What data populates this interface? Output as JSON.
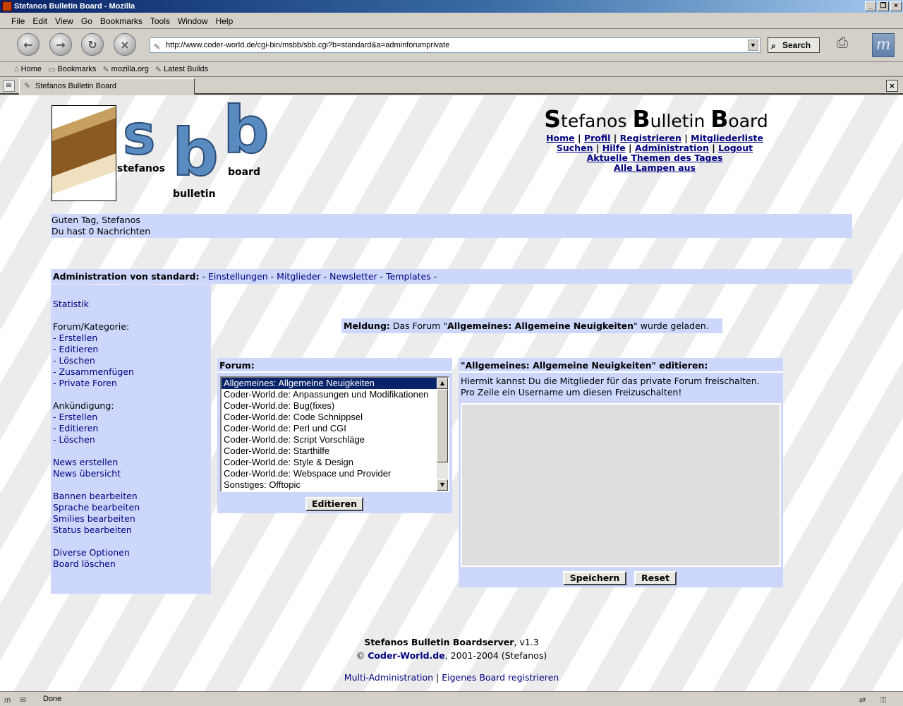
{
  "window": {
    "title": "Stefanos Bulletin Board - Mozilla"
  },
  "menu": [
    "File",
    "Edit",
    "View",
    "Go",
    "Bookmarks",
    "Tools",
    "Window",
    "Help"
  ],
  "navbar": {
    "url": "http://www.coder-world.de/cgi-bin/msbb/sbb.cgi?b=standard&a=adminforumprivate",
    "search_label": "Search"
  },
  "personal_toolbar": [
    "Home",
    "Bookmarks",
    "mozilla.org",
    "Latest Builds"
  ],
  "tab": {
    "title": "Stefanos Bulletin Board"
  },
  "logo": {
    "letter_s": "s",
    "letter_b1": "b",
    "letter_b2": "b",
    "word1": "stefanos",
    "word2": "bulletin",
    "word3": "board"
  },
  "header": {
    "title_parts": [
      {
        "cap": "S",
        "rest": "tefanos "
      },
      {
        "cap": "B",
        "rest": "ulletin "
      },
      {
        "cap": "B",
        "rest": "oard"
      }
    ],
    "sep": " | ",
    "links_row1": [
      "Home",
      "Profil",
      "Registrieren",
      "Mitgliederliste"
    ],
    "links_row2": [
      "Suchen",
      "Hilfe",
      "Administration",
      "Logout"
    ],
    "links_row3": [
      "Aktuelle Themen des Tages"
    ],
    "links_row4": [
      "Alle Lampen aus"
    ]
  },
  "greeting": {
    "line1": "Guten Tag, Stefanos",
    "line2": "Du hast 0 Nachrichten"
  },
  "adminbar": {
    "label": "Administration von standard:",
    "sep": " - ",
    "links": [
      "Einstellungen",
      "Mitglieder",
      "Newsletter",
      "Templates"
    ]
  },
  "sidebar": {
    "groups": [
      {
        "items": [
          "Statistik"
        ]
      },
      {
        "heading": "Forum/Kategorie:",
        "items": [
          "- Erstellen",
          "- Editieren",
          "- Löschen",
          "- Zusammenfügen",
          "- Private Foren"
        ]
      },
      {
        "heading": "Ankündigung:",
        "items": [
          "- Erstellen",
          "- Editieren",
          "- Löschen"
        ]
      },
      {
        "items": [
          "News erstellen",
          "News übersicht"
        ]
      },
      {
        "items": [
          "Bannen bearbeiten",
          "Sprache bearbeiten",
          "Smilies bearbeiten",
          "Status bearbeiten"
        ]
      },
      {
        "items": [
          "Diverse Optionen",
          "Board löschen"
        ]
      }
    ]
  },
  "message": {
    "label": "Meldung:",
    "pre": " Das Forum \"",
    "forum": "Allgemeines: Allgemeine Neuigkeiten",
    "post": "\" wurde geladen."
  },
  "forum_panel": {
    "header": "Forum:",
    "options": [
      "Allgemeines: Allgemeine Neuigkeiten",
      "Coder-World.de: Anpassungen und Modifikationen",
      "Coder-World.de: Bug(fixes)",
      "Coder-World.de: Code Schnippsel",
      "Coder-World.de: Perl und CGI",
      "Coder-World.de: Script Vorschläge",
      "Coder-World.de: Starthilfe",
      "Coder-World.de: Style & Design",
      "Coder-World.de: Webspace und Provider",
      "Sonstiges: Offtopic"
    ],
    "selected_index": 0,
    "button": "Editieren"
  },
  "edit_panel": {
    "header": "\"Allgemeines: Allgemeine Neuigkeiten\" editieren:",
    "line1": "Hiermit kannst Du die Mitglieder für das private Forum freischalten.",
    "line2": "Pro Zeile ein Username um diesen Freizuschalten!",
    "textarea_value": "",
    "save": "Speichern",
    "reset": "Reset"
  },
  "footer": {
    "name": "Stefanos Bulletin Boardserver",
    "version": ", v1.3",
    "copy": "© ",
    "site": "Coder-World.de",
    "years": ", 2001-2004 (Stefanos)",
    "link1": "Multi-Administration",
    "sep": " | ",
    "link2": "Eigenes Board registrieren"
  },
  "status": {
    "text": "Done"
  },
  "colors": {
    "panel": "#cdd6fb",
    "link": "#000080",
    "selection": "#0a246a"
  }
}
